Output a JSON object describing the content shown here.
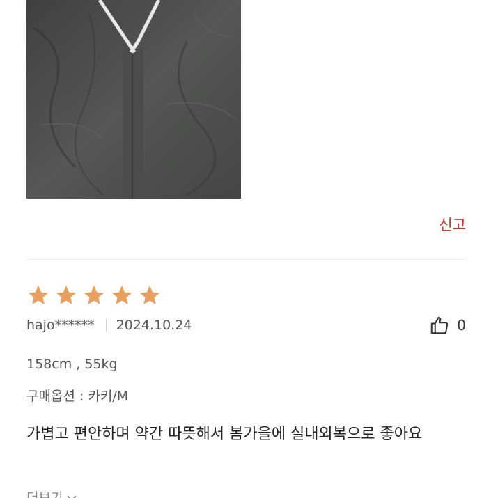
{
  "review": {
    "photo_alt": "review-photo",
    "report_label": "신고",
    "rating": 5,
    "rating_max": 5,
    "star_color": "#e8a060",
    "author": "hajo******",
    "date": "2024.10.24",
    "like_count": "0",
    "body_spec": "158cm , 55kg",
    "option": "구매옵션 : 카키/M",
    "text": "가볍고 편안하며 약간 따뜻해서 봄가을에 실내외복으로 좋아요",
    "more_label": "더보기"
  },
  "colors": {
    "report": "#c0392b",
    "divider": "#ececec"
  }
}
